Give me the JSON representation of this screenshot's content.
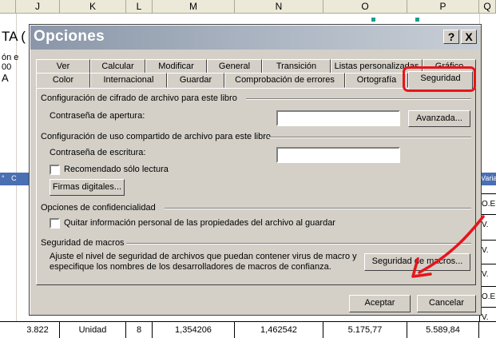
{
  "spreadsheet": {
    "columns": [
      "J",
      "K",
      "L",
      "M",
      "N",
      "O",
      "P",
      "Q"
    ],
    "fragments": {
      "row1": "TA (",
      "row2a": "ón e",
      "row2b": "00",
      "row3": "A",
      "left_degree": "°",
      "left_c": "C",
      "right_top": "Varia",
      "right_cells": [
        "O.E",
        "V.",
        "V.",
        "V.",
        "O.E",
        "V."
      ]
    },
    "bottom_row": [
      "3.822",
      "Unidad",
      "8",
      "1,354206",
      "1,462542",
      "5.175,77",
      "5.589,84"
    ]
  },
  "dialog": {
    "title": "Opciones",
    "help_button": "?",
    "close_button": "X",
    "tabs_back": [
      "Ver",
      "Calcular",
      "Modificar",
      "General",
      "Transición",
      "Listas personalizadas",
      "Gráfico"
    ],
    "tabs_front": [
      "Color",
      "Internacional",
      "Guardar",
      "Comprobación de errores",
      "Ortografía",
      "Seguridad"
    ],
    "groups": {
      "cifrado": "Configuración de cifrado de archivo para este libro",
      "compartido": "Configuración de uso compartido de archivo para este libro",
      "confidencialidad": "Opciones de confidencialidad",
      "macros": "Seguridad de macros"
    },
    "labels": {
      "pw_open": "Contraseña de apertura:",
      "pw_write": "Contraseña de escritura:",
      "readonly": "Recomendado sólo lectura",
      "privacy": "Quitar información personal de las propiedades del archivo al guardar",
      "macro_desc_1": "Ajuste el nivel de seguridad de archivos que puedan contener virus de macro y",
      "macro_desc_2": "especifique los nombres de los desarrolladores de macros de confianza."
    },
    "values": {
      "pw_open": "",
      "pw_write": ""
    },
    "buttons": {
      "advanced": "Avanzada...",
      "signatures": "Firmas digitales...",
      "macro_security": "Seguridad de macros...",
      "ok": "Aceptar",
      "cancel": "Cancelar"
    },
    "checked": {
      "readonly": false,
      "privacy": false
    }
  },
  "colors": {
    "highlight": "#e8141b",
    "arrow": "#e8141b",
    "titlebar": "#8a96a8",
    "panel": "#d4d0c8"
  }
}
